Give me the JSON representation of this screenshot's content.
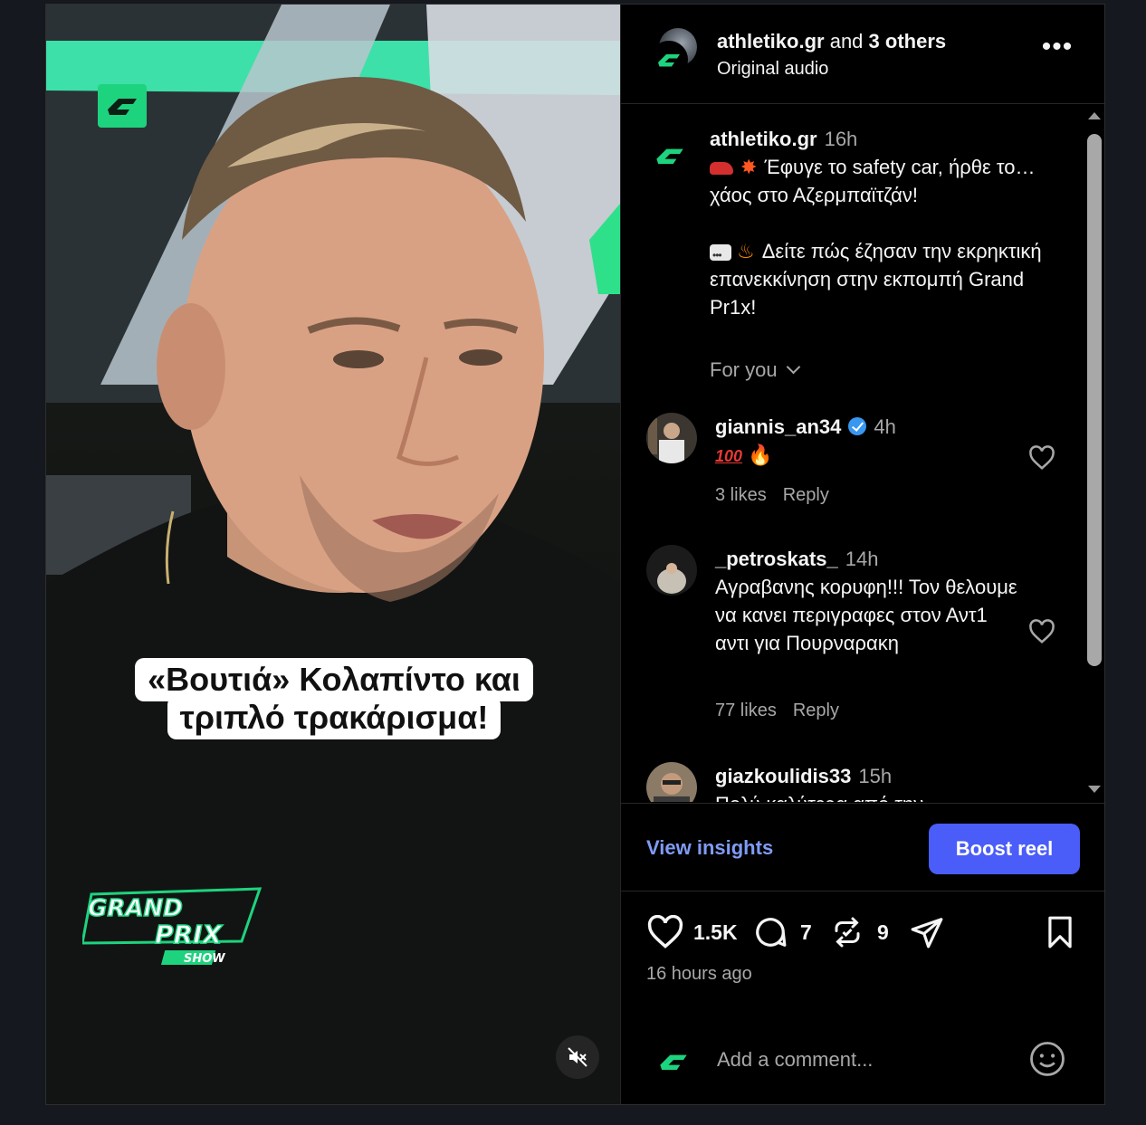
{
  "video": {
    "caption_line1": "«Βουτιά» Κολαπίντο και",
    "caption_line2": "τριπλό τρακάρισμα!",
    "show_logo": [
      "GRAND",
      "PRIX",
      "SHOW"
    ]
  },
  "header": {
    "author": "athletiko.gr",
    "connector": "and",
    "others": "3 others",
    "audio": "Original audio"
  },
  "caption": {
    "username": "athletiko.gr",
    "time": "16h",
    "paragraph1": "Έφυγε το safety car, ήρθε το… χάος στο Αζερμπαϊτζάν!",
    "paragraph2": "Δείτε πώς έζησαν την εκρηκτική επανεκκίνηση στην εκπομπή Grand Pr1x!"
  },
  "sort": {
    "label": "For you"
  },
  "comments": [
    {
      "username": "giannis_an34",
      "verified": true,
      "time": "4h",
      "text": "🔥",
      "emoji_100": "100",
      "likes": "3 likes",
      "reply": "Reply"
    },
    {
      "username": "_petroskats_",
      "verified": false,
      "time": "14h",
      "text": "Αγραβανης κορυφη!!! Τον θελουμε να κανει περιγραφες στον Αντ1 αντι για Πουρναρακη",
      "likes": "77 likes",
      "reply": "Reply"
    },
    {
      "username": "giazkoulidis33",
      "verified": false,
      "time": "15h",
      "text": "Πολύ καλύτερα από την"
    }
  ],
  "actions": {
    "insights": "View insights",
    "boost": "Boost reel"
  },
  "stats": {
    "likes": "1.5K",
    "comments": "7",
    "reposts": "9",
    "posted": "16 hours ago"
  },
  "composer": {
    "placeholder": "Add a comment..."
  },
  "colors": {
    "brand": "#1ed37e",
    "accent": "#4a5df9",
    "link": "#7f9cf5"
  }
}
